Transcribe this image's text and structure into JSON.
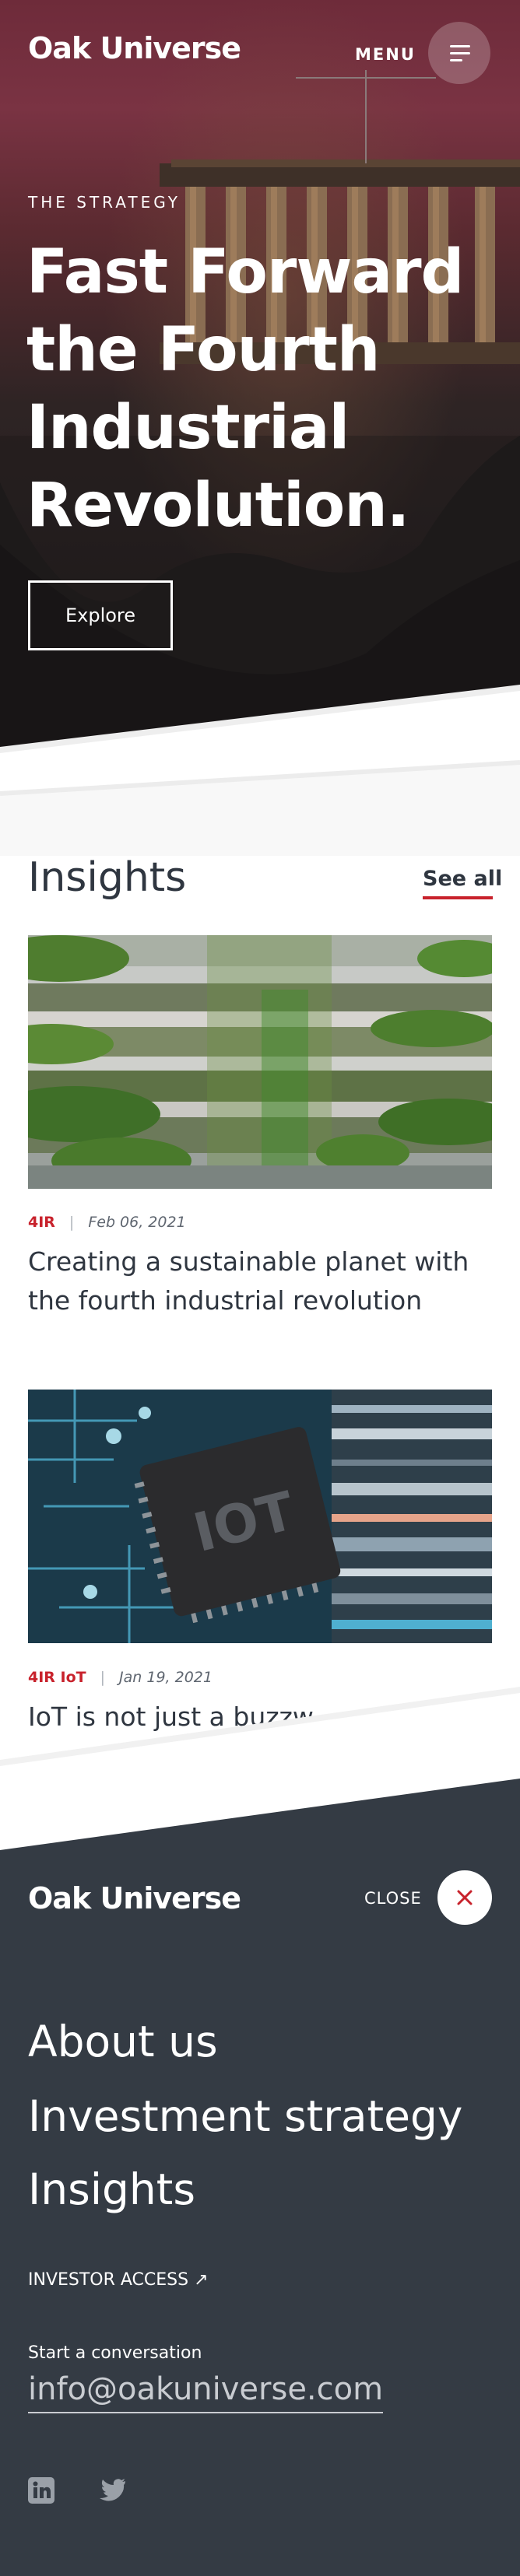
{
  "header": {
    "logo": "Oak Universe",
    "menu_label": "MENU"
  },
  "hero": {
    "eyebrow": "THE STRATEGY",
    "title_lines": [
      "Fast Forward",
      "the Fourth",
      "Industrial",
      "Revolution."
    ],
    "button_label": "Explore"
  },
  "insights": {
    "heading": "Insights",
    "see_all": "See all",
    "articles": [
      {
        "category": "4IR",
        "date": "Feb 06, 2021",
        "title_lines": [
          "Creating a sustainable planet with",
          "the fourth industrial revolution"
        ]
      },
      {
        "category": "4IR IoT",
        "date": "Jan 19, 2021",
        "title_lines": [
          "IoT is not just a buzzw"
        ],
        "image_text": "IOT"
      }
    ]
  },
  "menu_overlay": {
    "logo": "Oak Universe",
    "close_label": "CLOSE",
    "nav_items": [
      "About us",
      "Investment strategy",
      "Insights"
    ],
    "investor_access": "INVESTOR ACCESS ↗",
    "conversation_label": "Start a conversation",
    "email": "info@oakuniverse.com",
    "social": [
      "linkedin-icon",
      "twitter-icon"
    ]
  },
  "colors": {
    "accent_red": "#c8222c",
    "overlay_bg": "#343b44",
    "text_dark": "#2f3640"
  }
}
